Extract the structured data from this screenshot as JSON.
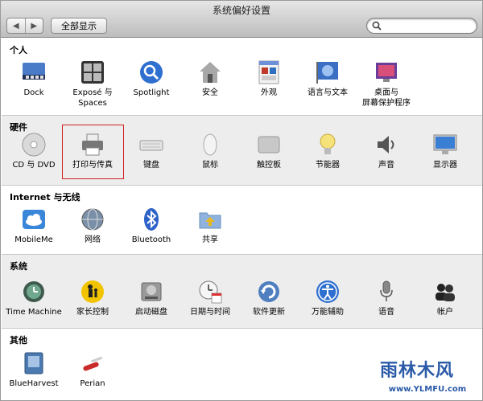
{
  "window": {
    "title": "系统偏好设置"
  },
  "toolbar": {
    "back_glyph": "◀",
    "forward_glyph": "▶",
    "show_all_label": "全部显示",
    "search_value": ""
  },
  "sections": {
    "personal": {
      "title": "个人",
      "items": [
        {
          "label": "Dock",
          "icon": "dock-icon"
        },
        {
          "label": "Exposé 与\nSpaces",
          "icon": "expose-icon"
        },
        {
          "label": "Spotlight",
          "icon": "spotlight-icon"
        },
        {
          "label": "安全",
          "icon": "security-house-icon"
        },
        {
          "label": "外观",
          "icon": "appearance-icon"
        },
        {
          "label": "语言与文本",
          "icon": "flag-globe-icon"
        },
        {
          "label": "桌面与\n屏幕保护程序",
          "icon": "desktop-screensaver-icon"
        }
      ]
    },
    "hardware": {
      "title": "硬件",
      "items": [
        {
          "label": "CD 与 DVD",
          "icon": "cd-icon"
        },
        {
          "label": "打印与传真",
          "icon": "printer-icon"
        },
        {
          "label": "键盘",
          "icon": "keyboard-icon"
        },
        {
          "label": "鼠标",
          "icon": "mouse-icon"
        },
        {
          "label": "触控板",
          "icon": "trackpad-icon"
        },
        {
          "label": "节能器",
          "icon": "lightbulb-icon"
        },
        {
          "label": "声音",
          "icon": "speaker-icon"
        },
        {
          "label": "显示器",
          "icon": "display-icon"
        }
      ]
    },
    "internet": {
      "title": "Internet 与无线",
      "items": [
        {
          "label": "MobileMe",
          "icon": "cloud-icon"
        },
        {
          "label": "网络",
          "icon": "network-globe-icon"
        },
        {
          "label": "Bluetooth",
          "icon": "bluetooth-icon"
        },
        {
          "label": "共享",
          "icon": "sharing-folder-icon"
        }
      ]
    },
    "system": {
      "title": "系统",
      "items": [
        {
          "label": "Time Machine",
          "icon": "time-machine-icon"
        },
        {
          "label": "家长控制",
          "icon": "parental-controls-icon"
        },
        {
          "label": "启动磁盘",
          "icon": "startup-disk-icon"
        },
        {
          "label": "日期与时间",
          "icon": "clock-calendar-icon"
        },
        {
          "label": "软件更新",
          "icon": "software-update-icon"
        },
        {
          "label": "万能辅助",
          "icon": "universal-access-icon"
        },
        {
          "label": "语音",
          "icon": "microphone-icon"
        },
        {
          "label": "帐户",
          "icon": "accounts-icon"
        }
      ]
    },
    "other": {
      "title": "其他",
      "items": [
        {
          "label": "BlueHarvest",
          "icon": "blueharvest-icon"
        },
        {
          "label": "Perian",
          "icon": "perian-knife-icon"
        }
      ]
    }
  },
  "watermark": {
    "text": "雨林木风",
    "url": "www.YLMFU.com"
  },
  "colors": {
    "section_alt_bg": "#ededed",
    "highlight_border": "#d02020",
    "accent_blue": "#2a5aa8"
  }
}
